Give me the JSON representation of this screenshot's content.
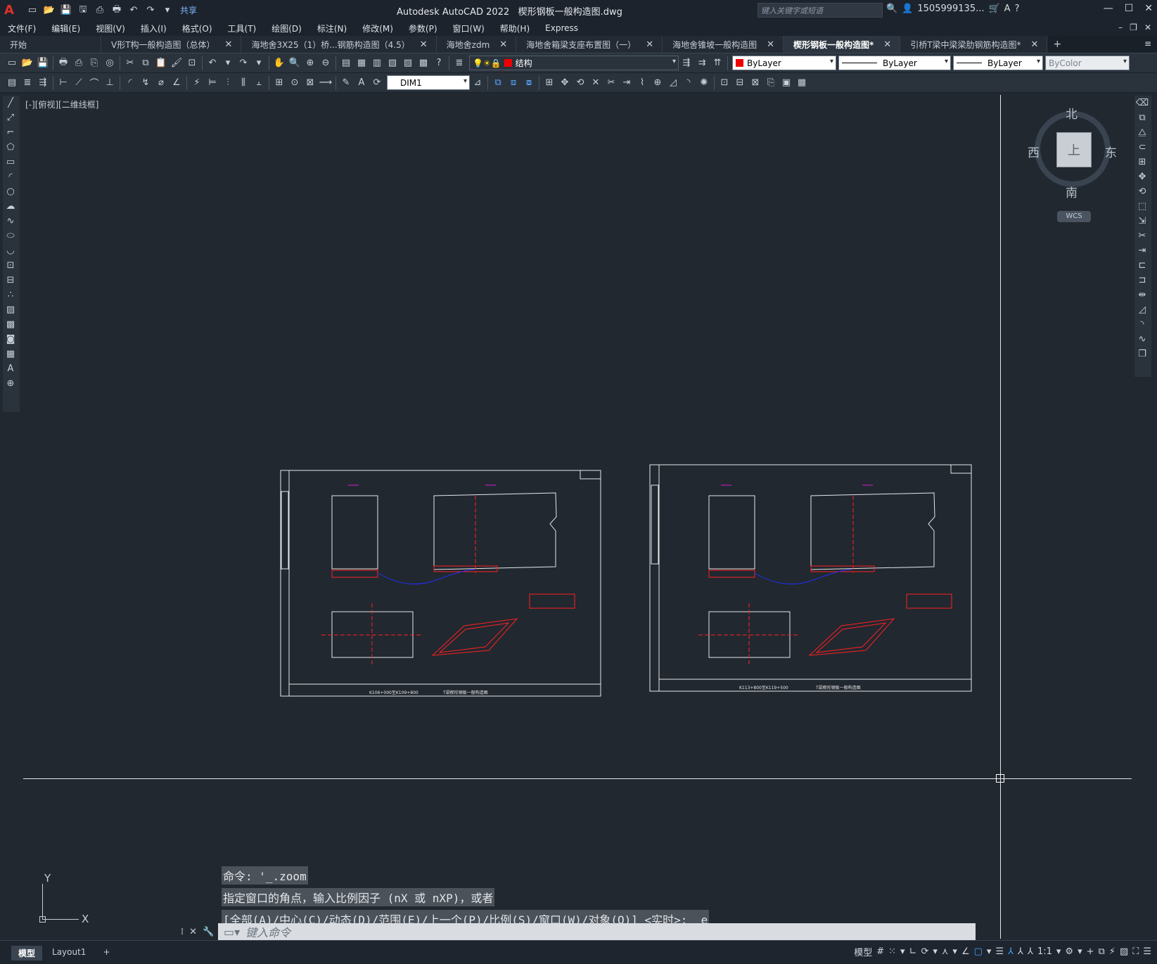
{
  "app": {
    "title": "Autodesk AutoCAD 2022",
    "document": "楔形钢板一般构造图.dwg",
    "logo": "A"
  },
  "qat": {
    "share_label": "共享",
    "icons": [
      "new-icon",
      "open-icon",
      "save-icon",
      "saveas-icon",
      "plot-icon",
      "print-icon",
      "undo-icon",
      "redo-icon",
      "dropdown-icon"
    ]
  },
  "search": {
    "placeholder": "键入关键字或短语"
  },
  "user": {
    "name": "1505999135..."
  },
  "menu": [
    "文件(F)",
    "编辑(E)",
    "视图(V)",
    "插入(I)",
    "格式(O)",
    "工具(T)",
    "绘图(D)",
    "标注(N)",
    "修改(M)",
    "参数(P)",
    "窗口(W)",
    "帮助(H)",
    "Express"
  ],
  "tabs": [
    {
      "label": "开始",
      "closable": false,
      "active": false
    },
    {
      "label": "V形T构一般构造图（总体）",
      "closable": true,
      "active": false
    },
    {
      "label": "海地舍3X25（1）桥...钢筋构造图（4.5）",
      "closable": true,
      "active": false
    },
    {
      "label": "海地舍zdm",
      "closable": true,
      "active": false
    },
    {
      "label": "海地舍箱梁支座布置图（一）",
      "closable": true,
      "active": false
    },
    {
      "label": "海地舍锥坡一般构造图",
      "closable": true,
      "active": false
    },
    {
      "label": "楔形钢板一般构造图*",
      "closable": true,
      "active": true
    },
    {
      "label": "引桥T梁中梁梁肋钢筋构造图*",
      "closable": true,
      "active": false
    }
  ],
  "toolbar": {
    "layer_name": "结构",
    "color": "ByLayer",
    "linetype": "ByLayer",
    "lineweight": "ByLayer",
    "plotstyle": "ByColor",
    "dimstyle": "DIM1"
  },
  "view": {
    "label": "[-][俯视][二维线框]"
  },
  "viewcube": {
    "north": "北",
    "south": "南",
    "east": "东",
    "west": "西",
    "face": "上",
    "wcs": "WCS"
  },
  "ucs": {
    "y": "Y",
    "x": "X"
  },
  "command": {
    "history": [
      "命令: '_.zoom",
      "指定窗口的角点，输入比例因子 (nX 或 nXP)，或者",
      "[全部(A)/中心(C)/动态(D)/范围(E)/上一个(P)/比例(S)/窗口(W)/对象(O)] <实时>: _e"
    ],
    "placeholder": "键入命令"
  },
  "layout_tabs": [
    "模型",
    "Layout1"
  ],
  "status": {
    "model": "模型",
    "scale": "1:1"
  },
  "sheets": [
    {
      "footer": "K106+000至K109+800",
      "title": "T梁楔形钢板一般构造图"
    },
    {
      "footer": "K113+800至K119+500",
      "title": "T梁楔形钢板一般构造图"
    }
  ],
  "colors": {
    "bg": "#212830",
    "accent_red": "#e0312b",
    "drawing_red": "#ff2020",
    "drawing_blue": "#2030ff",
    "drawing_magenta": "#d020d0"
  }
}
